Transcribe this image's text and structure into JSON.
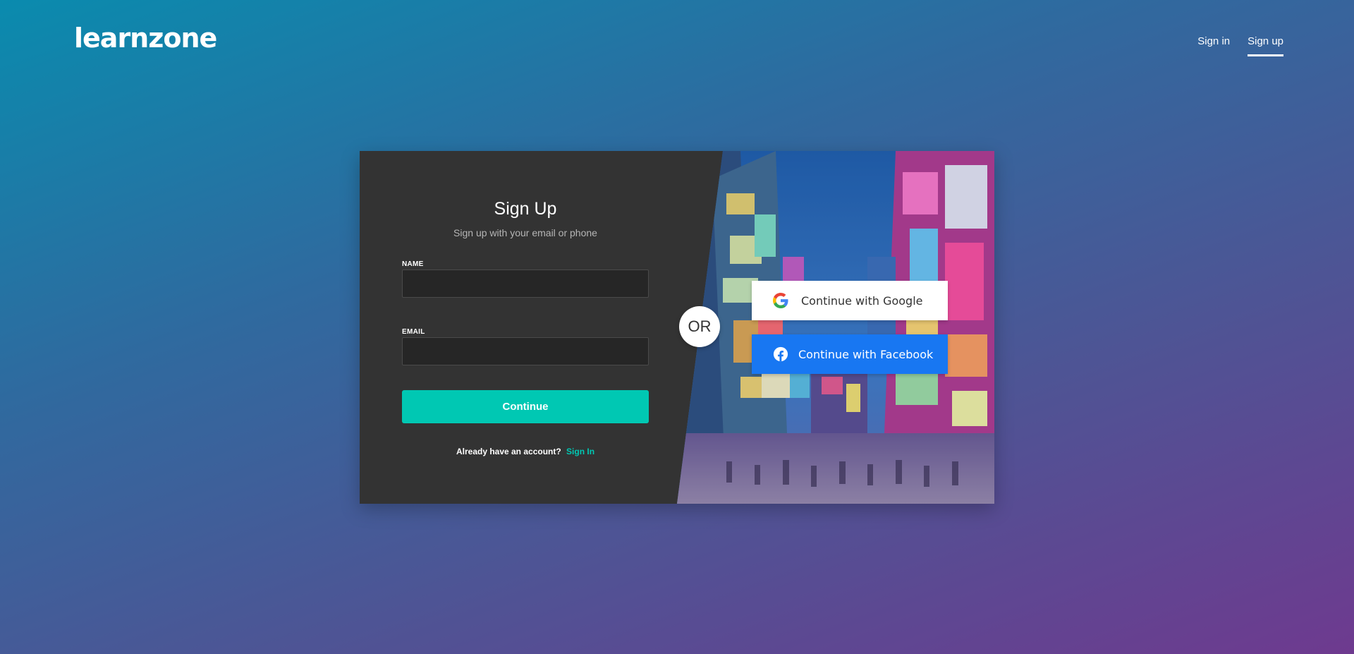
{
  "brand": {
    "logo_text": "learnzone"
  },
  "nav": {
    "sign_in": "Sign in",
    "sign_up": "Sign up"
  },
  "form": {
    "title": "Sign Up",
    "subtitle": "Sign up with your email or phone",
    "name_label": "NAME",
    "name_value": "",
    "email_label": "EMAIL",
    "email_value": "",
    "continue_label": "Continue",
    "already_text": "Already have an account?",
    "signin_link": "Sign In"
  },
  "divider": {
    "or_text": "OR"
  },
  "social": {
    "google_label": "Continue with Google",
    "facebook_label": "Continue with Facebook"
  },
  "colors": {
    "accent": "#00c8b3",
    "facebook": "#1877f2",
    "card_bg": "#333333",
    "bg_start": "#0a8bae",
    "bg_end": "#6e3a8f"
  },
  "icons": {
    "google": "google-icon",
    "facebook": "facebook-icon"
  }
}
